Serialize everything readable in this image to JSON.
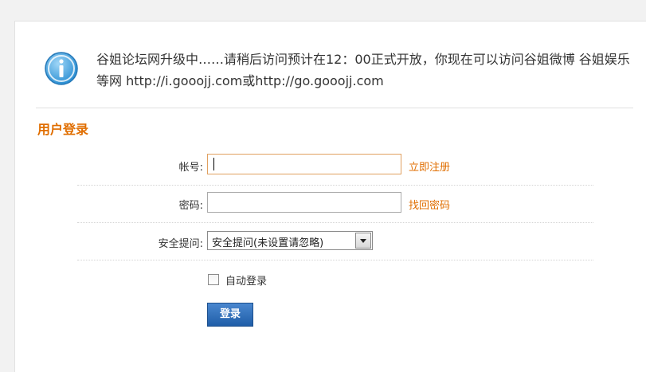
{
  "notice": {
    "icon": "info-icon",
    "text": "谷姐论坛网升级中……请稍后访问预计在12：00正式开放，你现在可以访问谷姐微博 谷姐娱乐 等网 http://i.gooojj.com或http://go.gooojj.com"
  },
  "login": {
    "title": "用户登录",
    "account_label": "帐号:",
    "account_value": "",
    "register_link": "立即注册",
    "password_label": "密码:",
    "password_value": "",
    "forgot_link": "找回密码",
    "question_label": "安全提问:",
    "question_selected": "安全提问(未设置请忽略)",
    "auto_login_label": "自动登录",
    "auto_login_checked": false,
    "submit_label": "登录"
  },
  "colors": {
    "accent": "#e06e00",
    "button": "#2a69b4",
    "info_icon": "#3a9ad9"
  }
}
